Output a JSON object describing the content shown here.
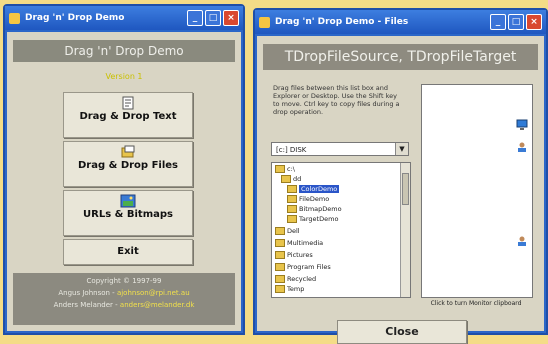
{
  "left_window": {
    "title": "Drag 'n' Drop Demo",
    "header": "Drag 'n' Drop Demo",
    "subtitle": "Version 1",
    "buttons": [
      {
        "label": "Drag & Drop Text"
      },
      {
        "label": "Drag & Drop Files"
      },
      {
        "label": "URLs & Bitmaps"
      },
      {
        "label": "Exit"
      }
    ],
    "footer": {
      "copyright": "Copyright © 1997-99",
      "row1_label": "Angus Johnson -",
      "row1_link": "ajohnson@rpi.net.au",
      "row2_label": "Anders Melander -",
      "row2_link": "anders@melander.dk"
    }
  },
  "right_window": {
    "title": "Drag 'n' Drop Demo - Files",
    "header": "TDropFileSource, TDropFileTarget",
    "description": "Drag files between this list box and Explorer or Desktop. Use the Shift key to move. Ctrl key to copy files during a drop operation.",
    "drive": "[c:] DISK",
    "tree": [
      {
        "label": "c:\\"
      },
      {
        "label": "dd"
      },
      {
        "label": "ColorDemo"
      },
      {
        "label": "FileDemo"
      },
      {
        "label": "BitmapDemo"
      },
      {
        "label": "TargetDemo"
      },
      {
        "label": "Dell"
      },
      {
        "label": "Multimedia"
      },
      {
        "label": "Pictures"
      },
      {
        "label": "Program Files"
      },
      {
        "label": "Recycled"
      },
      {
        "label": "Temp"
      }
    ],
    "hint": "Click to turn Monitor clipboard",
    "close_label": "Close"
  }
}
